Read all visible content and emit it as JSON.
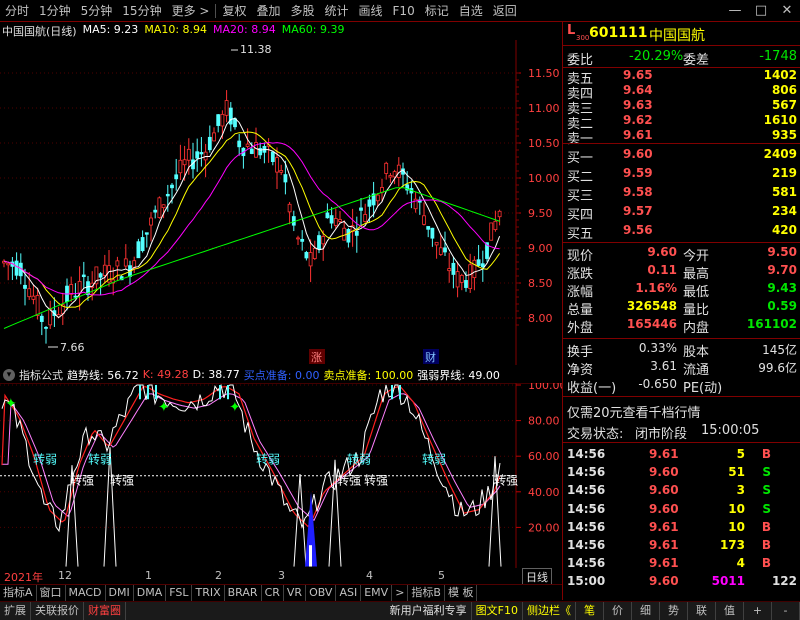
{
  "toolbar": {
    "items": [
      "分时",
      "1分钟",
      "5分钟",
      "15分钟",
      "更多 >",
      "复权",
      "叠加",
      "多股",
      "统计",
      "画线",
      "F10",
      "标记",
      "自选",
      "返回"
    ],
    "win_buttons": [
      "—",
      "□",
      "✕"
    ]
  },
  "main_chart": {
    "stock_label": "中国国航(日线)",
    "ma_labels": [
      "MA5: 9.23",
      "MA10: 8.94",
      "MA20: 8.94",
      "MA60: 9.39"
    ],
    "ma_colors": [
      "#ffffff",
      "#ffff00",
      "#ff00ff",
      "#00ff00"
    ],
    "price_axis": [
      "11.50",
      "11.00",
      "10.50",
      "10.00",
      "9.50",
      "9.00",
      "8.50",
      "8.00"
    ],
    "high_marker": "11.38",
    "low_marker": "7.66",
    "badge_zhang": "涨",
    "badge_cai": "财"
  },
  "indicator": {
    "title": "指标公式",
    "values": [
      {
        "text": "趋势线: 56.72",
        "color": "#ffffff"
      },
      {
        "text": "K: 49.28",
        "color": "#ff4040"
      },
      {
        "text": "D: 38.77",
        "color": "#ffffff"
      },
      {
        "text": "买点准备: 0.00",
        "color": "#3030ff"
      },
      {
        "text": "卖点准备: 100.00",
        "color": "#ffff00"
      },
      {
        "text": "强弱界线: 49.00",
        "color": "#ffffff"
      }
    ],
    "axis": [
      "100.00",
      "80.00",
      "60.00",
      "40.00",
      "20.00"
    ],
    "labels_weak": [
      "转弱",
      "转弱",
      "转弱",
      "转弱",
      "转弱"
    ],
    "labels_strong": [
      "转强",
      "转强",
      "转强",
      "转强",
      "转强"
    ]
  },
  "period_bar": {
    "labels": [
      "2021年",
      "12",
      "1",
      "2",
      "3",
      "4",
      "5"
    ],
    "right_label": "日线"
  },
  "tabs1": [
    "指标A",
    "窗口",
    "MACD",
    "DMI",
    "DMA",
    "FSL",
    "TRIX",
    "BRAR",
    "CR",
    "VR",
    "OBV",
    "ASI",
    "EMV",
    ">",
    "指标B",
    "模 板"
  ],
  "tabs2": [
    "扩展",
    "关联报价",
    "财富圈"
  ],
  "tabs2_right": [
    "新用户福利专享",
    "图文F10",
    "侧边栏《"
  ],
  "quote_tabs": [
    "笔",
    "价",
    "细",
    "势",
    "联",
    "值",
    "+",
    "-"
  ],
  "quote": {
    "code_prefix": "L",
    "code_sub": "300",
    "code": "601111",
    "name": "中国国航",
    "weibi_label": "委比",
    "weibi_value": "-20.29%",
    "weicha_label": "委差",
    "weicha_value": "-1748",
    "sells": [
      {
        "label": "卖五",
        "price": "9.65",
        "vol": "1402"
      },
      {
        "label": "卖四",
        "price": "9.64",
        "vol": "806"
      },
      {
        "label": "卖三",
        "price": "9.63",
        "vol": "567"
      },
      {
        "label": "卖二",
        "price": "9.62",
        "vol": "1610"
      },
      {
        "label": "卖一",
        "price": "9.61",
        "vol": "935"
      }
    ],
    "buys": [
      {
        "label": "买一",
        "price": "9.60",
        "vol": "2409"
      },
      {
        "label": "买二",
        "price": "9.59",
        "vol": "219"
      },
      {
        "label": "买三",
        "price": "9.58",
        "vol": "581"
      },
      {
        "label": "买四",
        "price": "9.57",
        "vol": "234"
      },
      {
        "label": "买五",
        "price": "9.56",
        "vol": "420"
      }
    ],
    "stats": [
      {
        "l1": "现价",
        "v1": "9.60",
        "c1": "red",
        "l2": "今开",
        "v2": "9.50",
        "c2": "red"
      },
      {
        "l1": "涨跌",
        "v1": "0.11",
        "c1": "red",
        "l2": "最高",
        "v2": "9.70",
        "c2": "red"
      },
      {
        "l1": "涨幅",
        "v1": "1.16%",
        "c1": "red",
        "l2": "最低",
        "v2": "9.43",
        "c2": "green"
      },
      {
        "l1": "总量",
        "v1": "326548",
        "c1": "yellow",
        "l2": "量比",
        "v2": "0.59",
        "c2": "green"
      },
      {
        "l1": "外盘",
        "v1": "165446",
        "c1": "red",
        "l2": "内盘",
        "v2": "161102",
        "c2": "green"
      }
    ],
    "stats2": [
      {
        "l1": "换手",
        "v1": "0.33%",
        "l2": "股本",
        "v2": "145亿"
      },
      {
        "l1": "净资",
        "v1": "3.61",
        "l2": "流通",
        "v2": "99.6亿"
      },
      {
        "l1": "收益(一)",
        "v1": "-0.650",
        "l2": "PE(动)",
        "v2": ""
      }
    ],
    "promo": "仅需20元查看千档行情",
    "trade_status_label": "交易状态:",
    "trade_status": "闭市阶段",
    "trade_time": "15:00:05",
    "ticks": [
      {
        "t": "14:56",
        "p": "9.61",
        "v": "5",
        "s": "B"
      },
      {
        "t": "14:56",
        "p": "9.60",
        "v": "51",
        "s": "S"
      },
      {
        "t": "14:56",
        "p": "9.60",
        "v": "3",
        "s": "S"
      },
      {
        "t": "14:56",
        "p": "9.60",
        "v": "10",
        "s": "S"
      },
      {
        "t": "14:56",
        "p": "9.61",
        "v": "10",
        "s": "B"
      },
      {
        "t": "14:56",
        "p": "9.61",
        "v": "173",
        "s": "B"
      },
      {
        "t": "14:56",
        "p": "9.61",
        "v": "4",
        "s": "B"
      },
      {
        "t": "15:00",
        "p": "9.60",
        "v": "5011",
        "s": "122"
      }
    ]
  }
}
